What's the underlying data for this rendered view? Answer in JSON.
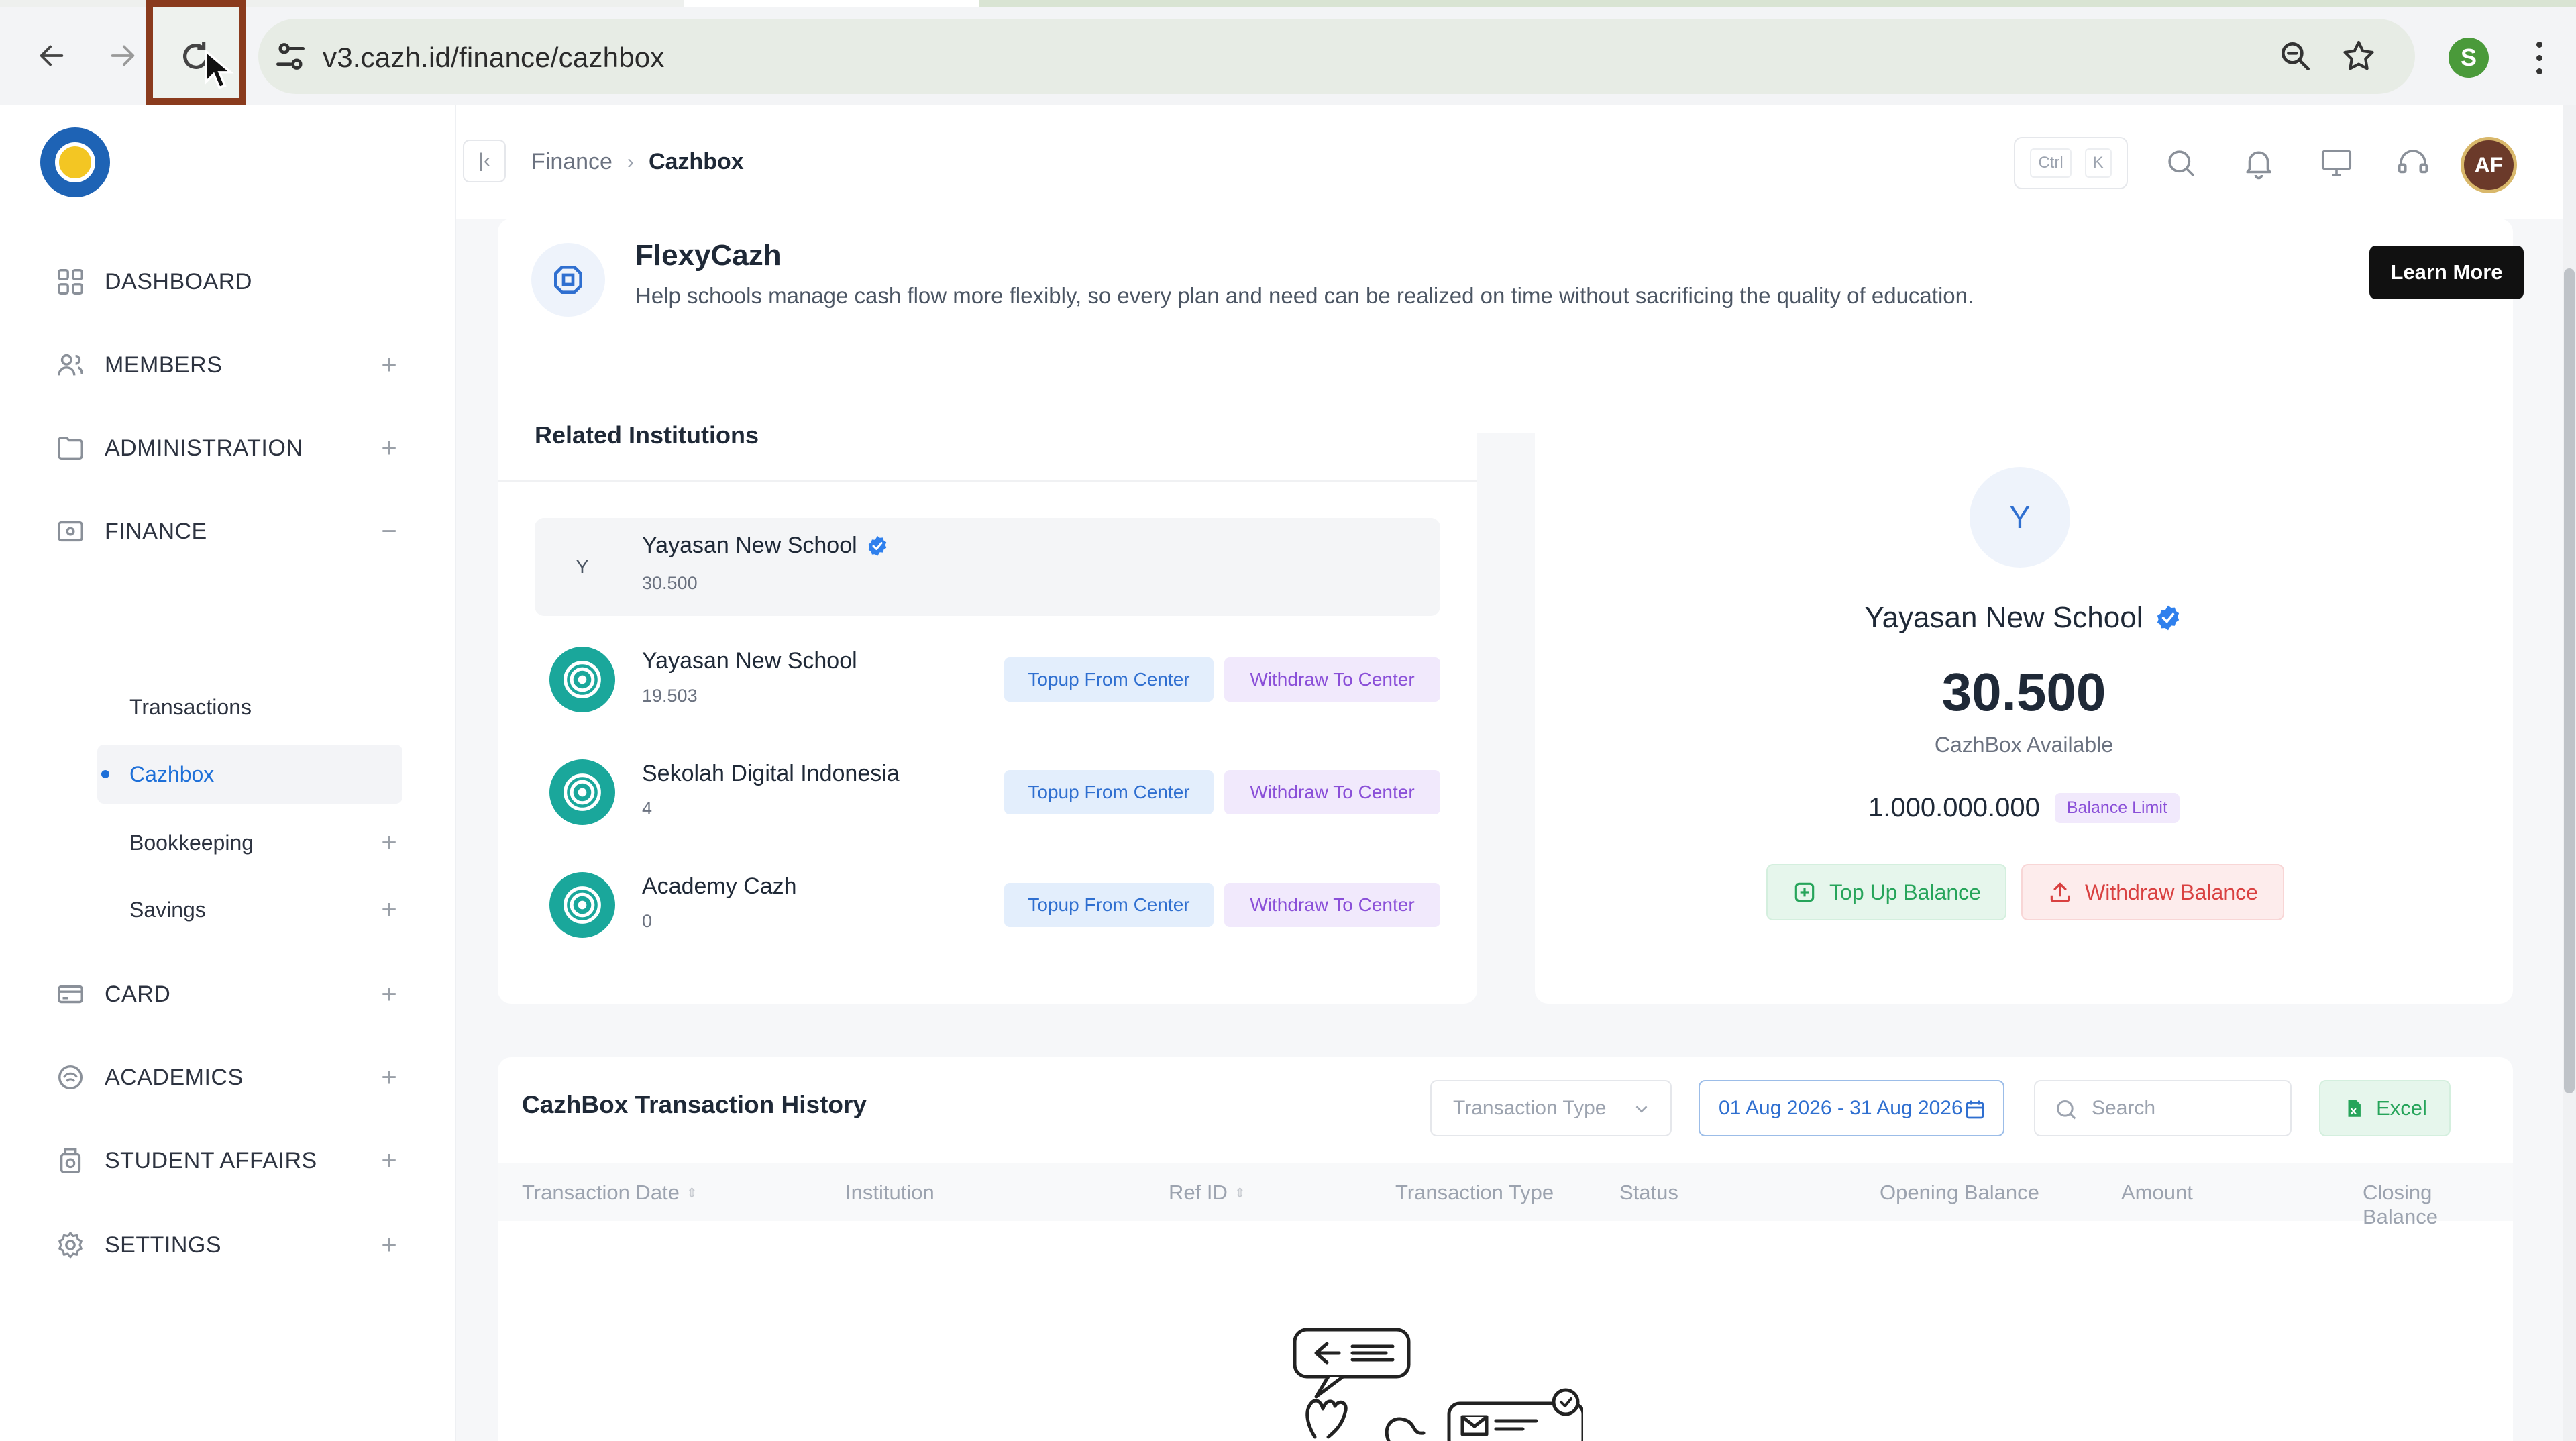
{
  "browser": {
    "url": "v3.cazh.id/finance/cazhbox",
    "profile_initial": "S"
  },
  "sidebar": {
    "items": [
      {
        "label": "DASHBOARD",
        "icon": "grid-icon",
        "toggle": ""
      },
      {
        "label": "MEMBERS",
        "icon": "users-icon",
        "toggle": "+"
      },
      {
        "label": "ADMINISTRATION",
        "icon": "folder-icon",
        "toggle": "+"
      },
      {
        "label": "FINANCE",
        "icon": "wallet-icon",
        "toggle": "−"
      },
      {
        "label": "CARD",
        "icon": "card-icon",
        "toggle": "+"
      },
      {
        "label": "ACADEMICS",
        "icon": "academics-icon",
        "toggle": "+"
      },
      {
        "label": "STUDENT AFFAIRS",
        "icon": "student-affairs-icon",
        "toggle": "+"
      },
      {
        "label": "SETTINGS",
        "icon": "settings-icon",
        "toggle": "+"
      }
    ],
    "finance_sub": [
      {
        "label": "Transactions",
        "toggle": ""
      },
      {
        "label": "Cazhbox",
        "toggle": ""
      },
      {
        "label": "Bookkeeping",
        "toggle": "+"
      },
      {
        "label": "Savings",
        "toggle": "+"
      }
    ]
  },
  "topbar": {
    "breadcrumb": [
      "Finance",
      "Cazhbox"
    ],
    "shortcut": [
      "Ctrl",
      "K"
    ],
    "avatar": "AF"
  },
  "banner": {
    "title": "FlexyCazh",
    "description": "Help schools manage cash flow more flexibly, so every plan and need can be realized on time without sacrificing the quality of education.",
    "button": "Learn More"
  },
  "related": {
    "title": "Related Institutions",
    "selected": {
      "initial": "Y",
      "name": "Yayasan New School",
      "value": "30.500"
    },
    "rows": [
      {
        "name": "Yayasan New School",
        "value": "19.503"
      },
      {
        "name": "Sekolah Digital Indonesia",
        "value": "4"
      },
      {
        "name": "Academy Cazh",
        "value": "0"
      }
    ],
    "topup_label": "Topup From Center",
    "withdraw_label": "Withdraw To Center"
  },
  "balance": {
    "initial": "Y",
    "name": "Yayasan New School",
    "amount": "30.500",
    "caption": "CazhBox Available",
    "limit": "1.000.000.000",
    "limit_badge": "Balance Limit",
    "topup_button": "Top Up Balance",
    "withdraw_button": "Withdraw Balance"
  },
  "history": {
    "title": "CazhBox Transaction History",
    "type_placeholder": "Transaction Type",
    "date_range": "01 Aug 2026 - 31 Aug 2026",
    "search_placeholder": "Search",
    "excel_button": "Excel",
    "columns": [
      "Transaction Date",
      "Institution",
      "Ref ID",
      "Transaction Type",
      "Status",
      "Opening Balance",
      "Amount",
      "Closing Balance"
    ]
  },
  "colors": {
    "accent": "#1d6fd8",
    "teal": "#1aa79b",
    "green": "#26a45a",
    "red": "#d94141",
    "purple": "#8a4fd8",
    "highlight": "#8a3b1d"
  }
}
